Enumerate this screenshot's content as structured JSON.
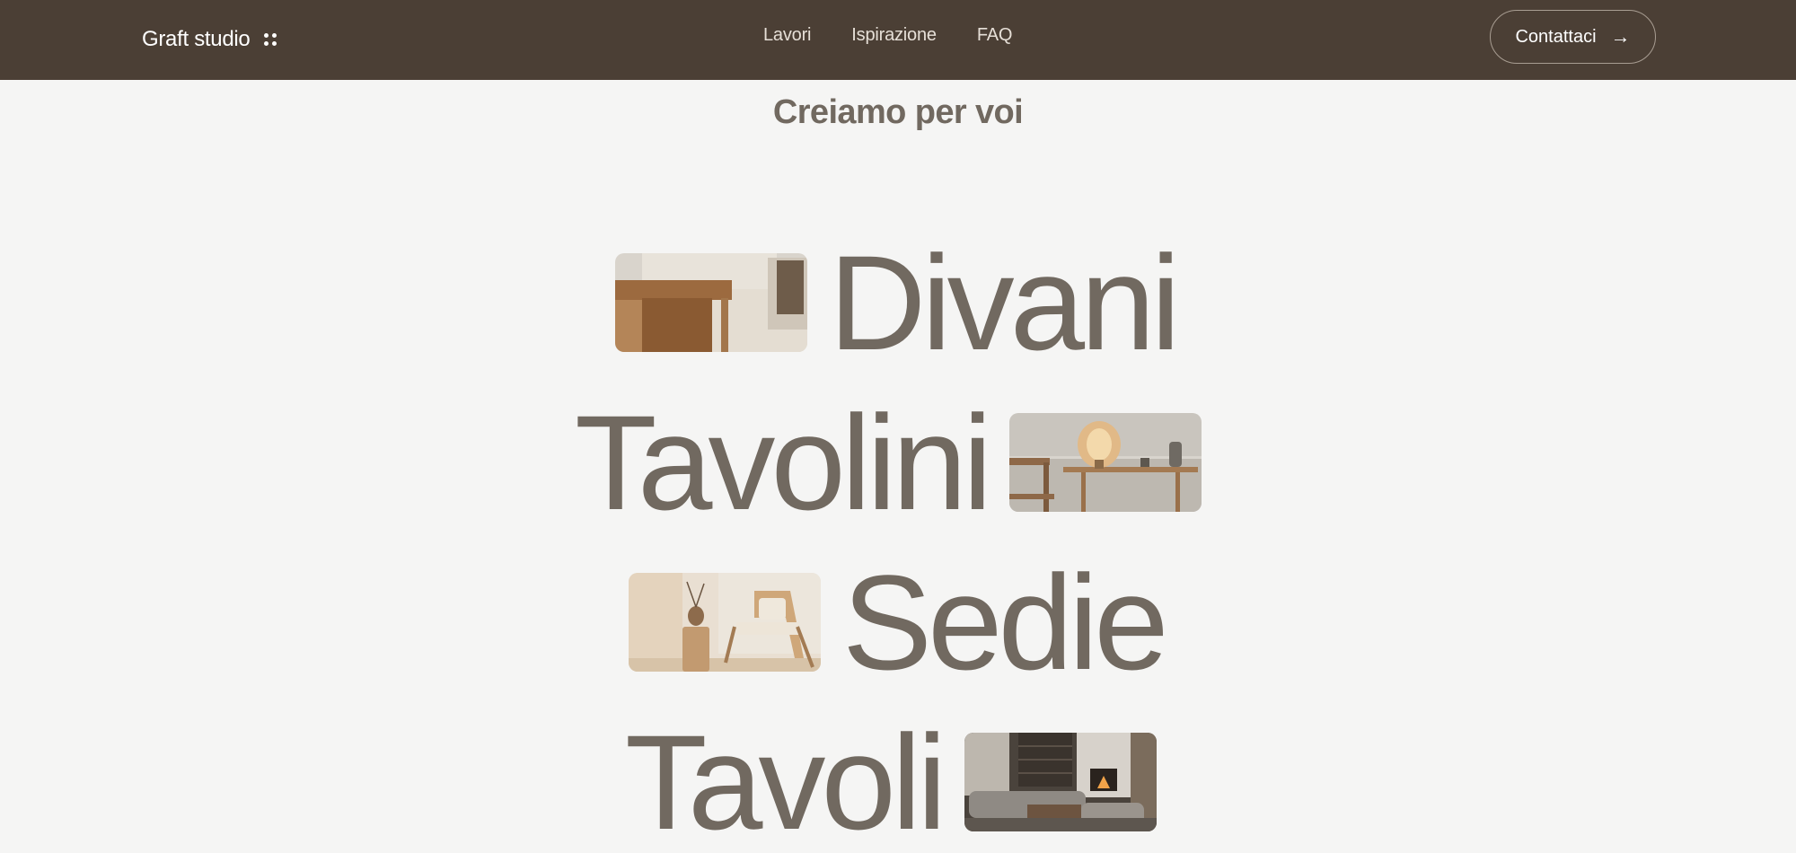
{
  "header": {
    "brand": "Graft studio",
    "nav": [
      "Lavori",
      "Ispirazione",
      "FAQ"
    ],
    "contact_label": "Contattaci",
    "contact_arrow": "→"
  },
  "hero": {
    "subtitle": "Creiamo per voi",
    "words": [
      "Divani",
      "Tavolini",
      "Sedie",
      "Tavoli"
    ]
  },
  "icons": [
    "four-dots-icon",
    "arrow-right-icon"
  ],
  "colors": {
    "header_bg": "#4b3f35",
    "page_bg": "#f5f5f4",
    "text_taupe": "#716960",
    "nav_text": "#e6dfd7"
  }
}
